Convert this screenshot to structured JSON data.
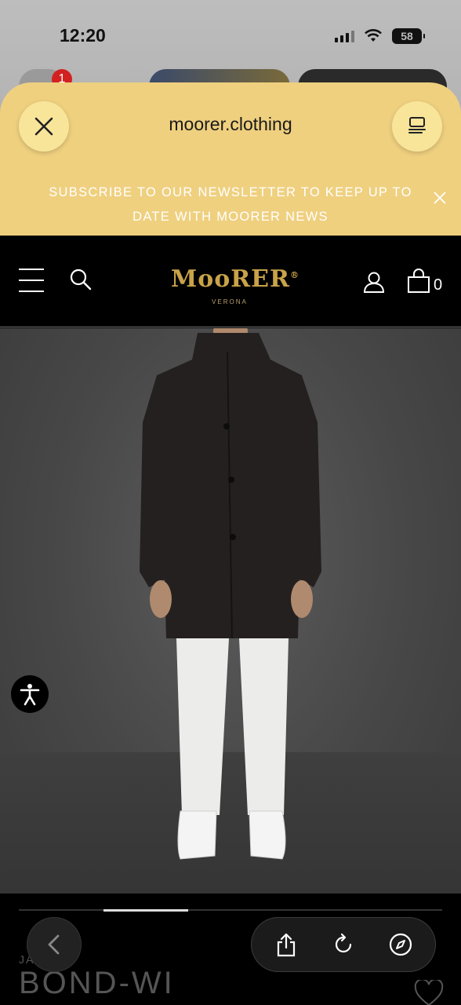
{
  "status_bar": {
    "time": "12:20",
    "battery": "58",
    "icons": [
      "cellular-signal-icon",
      "wifi-icon",
      "battery-icon"
    ]
  },
  "tab_switcher": {
    "notification_badge": "1"
  },
  "browser_sheet": {
    "url": "moorer.clothing",
    "close_icon": "close-icon",
    "tabs_icon": "tab-overview-icon",
    "background": "#efd07f"
  },
  "newsletter": {
    "text": "SUBSCRIBE TO OUR NEWSLETTER TO KEEP UP TO DATE WITH MOORER NEWS",
    "close_icon": "close-icon"
  },
  "site_header": {
    "logo": "MooRER",
    "logo_registered": "®",
    "logo_sub": "VERONA",
    "cart_count": "0",
    "icons": [
      "menu-icon",
      "search-icon",
      "account-icon",
      "shopping-bag-icon"
    ],
    "logo_color": "#c9a349"
  },
  "product": {
    "image_alt": "Man wearing dark coat with white trousers and white sneakers",
    "category_label": "JA",
    "name": "BOND-WI",
    "gallery_progress": 0.2
  },
  "accessibility": {
    "icon": "accessibility-icon"
  },
  "browser_toolbar": {
    "icons": [
      "back-icon",
      "share-icon",
      "reload-icon",
      "compass-icon"
    ]
  }
}
